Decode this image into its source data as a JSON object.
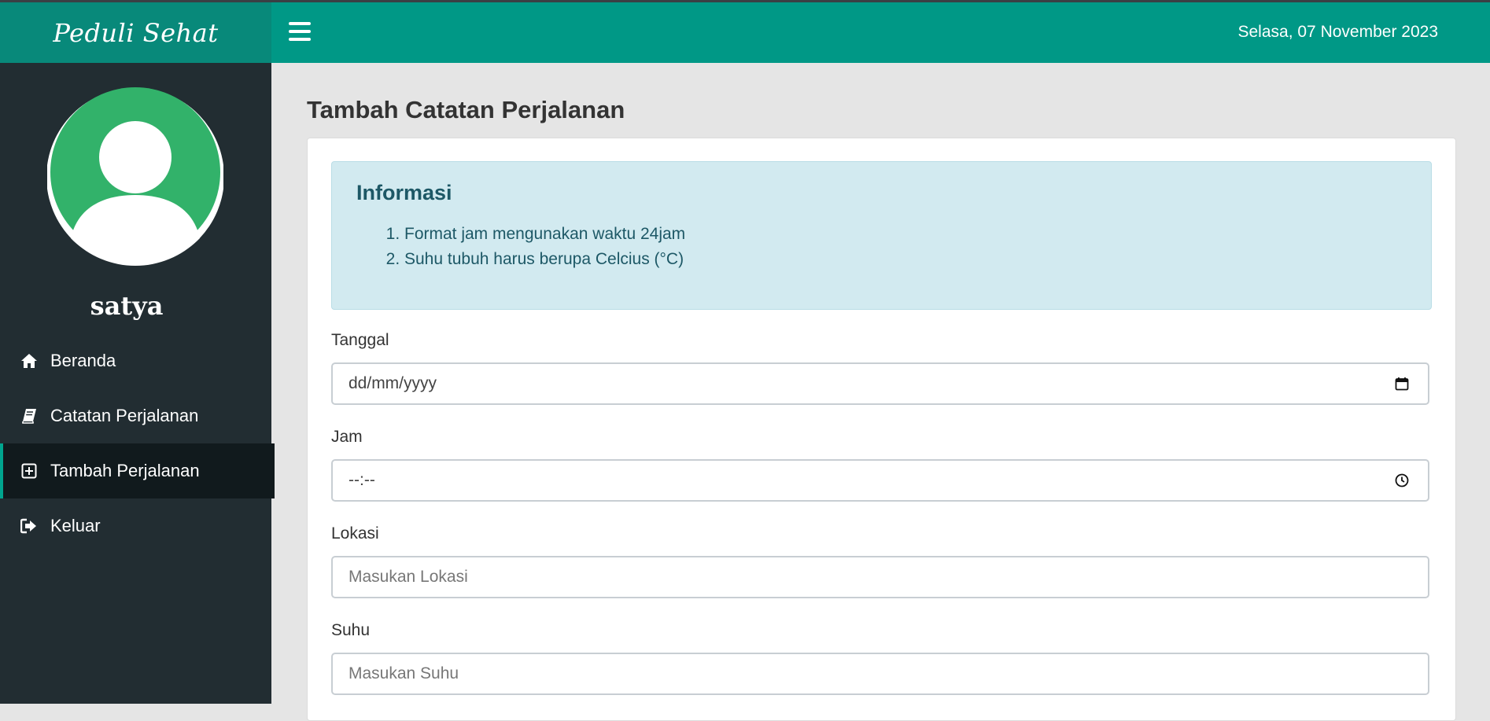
{
  "app": {
    "brand": "Peduli Sehat"
  },
  "header": {
    "date": "Selasa, 07 November 2023"
  },
  "sidebar": {
    "username": "satya",
    "items": [
      {
        "label": "Beranda",
        "icon": "home-icon"
      },
      {
        "label": "Catatan Perjalanan",
        "icon": "book-icon"
      },
      {
        "label": "Tambah Perjalanan",
        "icon": "plus-square-icon",
        "active": true
      },
      {
        "label": "Keluar",
        "icon": "sign-out-icon"
      }
    ]
  },
  "main": {
    "title": "Tambah Catatan Perjalanan",
    "info": {
      "title": "Informasi",
      "items": [
        "Format jam mengunakan waktu 24jam",
        "Suhu tubuh harus berupa Celcius (°C)"
      ]
    },
    "form": {
      "tanggal": {
        "label": "Tanggal",
        "value": "dd/mm/yyyy"
      },
      "jam": {
        "label": "Jam",
        "value": "--:--"
      },
      "lokasi": {
        "label": "Lokasi",
        "placeholder": "Masukan Lokasi"
      },
      "suhu": {
        "label": "Suhu",
        "placeholder": "Masukan Suhu"
      }
    }
  },
  "colors": {
    "header": "#009886",
    "brand_bg": "#08897a",
    "sidebar": "#222d32",
    "sidebar_active": "#111a1d",
    "avatar": "#32b26a",
    "info_bg": "#d2eaf0",
    "info_text": "#1d5866"
  }
}
